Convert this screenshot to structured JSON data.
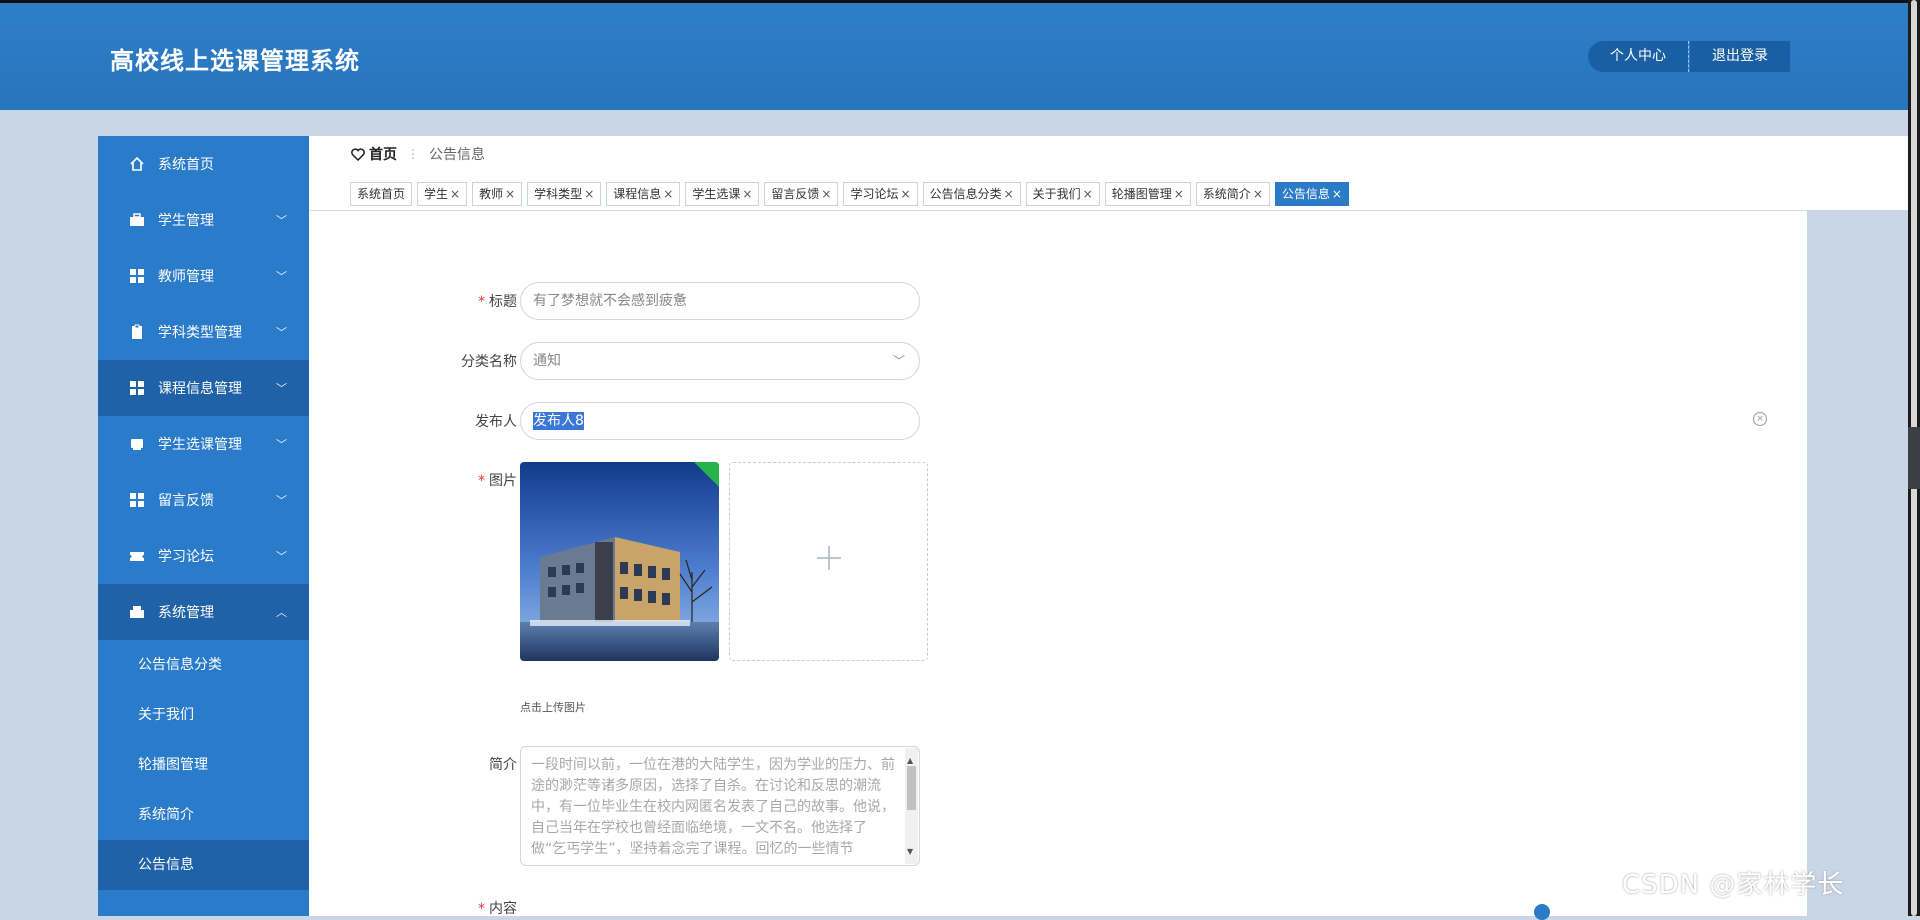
{
  "header": {
    "title": "高校线上选课管理系统",
    "personal_center": "个人中心",
    "logout": "退出登录"
  },
  "sidebar": {
    "items": [
      {
        "label": "系统首页",
        "icon": "home-icon"
      },
      {
        "label": "学生管理",
        "icon": "briefcase-icon"
      },
      {
        "label": "教师管理",
        "icon": "grid-icon"
      },
      {
        "label": "学科类型管理",
        "icon": "clipboard-icon"
      },
      {
        "label": "课程信息管理",
        "icon": "grid-icon"
      },
      {
        "label": "学生选课管理",
        "icon": "card-icon"
      },
      {
        "label": "留言反馈",
        "icon": "grid-icon"
      },
      {
        "label": "学习论坛",
        "icon": "ticket-icon"
      },
      {
        "label": "系统管理",
        "icon": "cabinet-icon"
      }
    ],
    "subitems": [
      "公告信息分类",
      "关于我们",
      "轮播图管理",
      "系统简介",
      "公告信息"
    ]
  },
  "breadcrumb": {
    "home": "首页",
    "current": "公告信息"
  },
  "tabs": [
    {
      "label": "系统首页",
      "closable": false
    },
    {
      "label": "学生",
      "closable": true
    },
    {
      "label": "教师",
      "closable": true
    },
    {
      "label": "学科类型",
      "closable": true
    },
    {
      "label": "课程信息",
      "closable": true
    },
    {
      "label": "学生选课",
      "closable": true
    },
    {
      "label": "留言反馈",
      "closable": true
    },
    {
      "label": "学习论坛",
      "closable": true
    },
    {
      "label": "公告信息分类",
      "closable": true
    },
    {
      "label": "关于我们",
      "closable": true
    },
    {
      "label": "轮播图管理",
      "closable": true
    },
    {
      "label": "系统简介",
      "closable": true
    },
    {
      "label": "公告信息",
      "closable": true
    }
  ],
  "tab_close_glyph": "×",
  "form": {
    "title_label": "标题",
    "title_value": "有了梦想就不会感到疲惫",
    "category_label": "分类名称",
    "category_value": "通知",
    "publisher_label": "发布人",
    "publisher_value": "发布人8",
    "image_label": "图片",
    "upload_hint": "点击上传图片",
    "intro_label": "简介",
    "intro_value": "一段时间以前，一位在港的大陆学生，因为学业的压力、前途的渺茫等诸多原因，选择了自杀。在讨论和反思的潮流中，有一位毕业生在校内网匿名发表了自己的故事。他说，自己当年在学校也曾经面临绝境，一文不名。他选择了做“乞丐学生”，坚持着念完了课程。回忆的一些情节",
    "content_label": "内容"
  },
  "watermark": "CSDN @家林学长",
  "colors": {
    "primary": "#2a7bc9",
    "active": "#1f62a8",
    "required": "#e33333"
  }
}
